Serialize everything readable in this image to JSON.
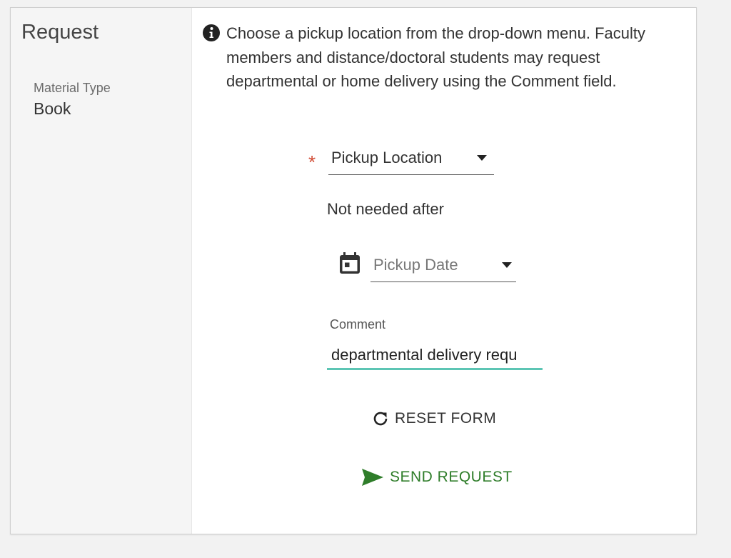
{
  "side": {
    "title": "Request",
    "material_type_label": "Material Type",
    "material_type_value": "Book"
  },
  "info": {
    "icon": "info-icon",
    "text": "Choose a pickup location from the drop-down menu. Faculty members and distance/doctoral students may request departmental or home delivery using the Comment field."
  },
  "form": {
    "required_marker": "*",
    "pickup_location": {
      "label": "Pickup Location",
      "required": true
    },
    "not_needed_after_label": "Not needed after",
    "pickup_date": {
      "placeholder": "Pickup Date"
    },
    "comment": {
      "label": "Comment",
      "value": "departmental delivery requ"
    },
    "reset_label": "RESET FORM",
    "send_label": "SEND REQUEST"
  },
  "colors": {
    "required": "#d14b34",
    "focus_underline": "#5cc5b4",
    "send": "#2f7d2a"
  }
}
